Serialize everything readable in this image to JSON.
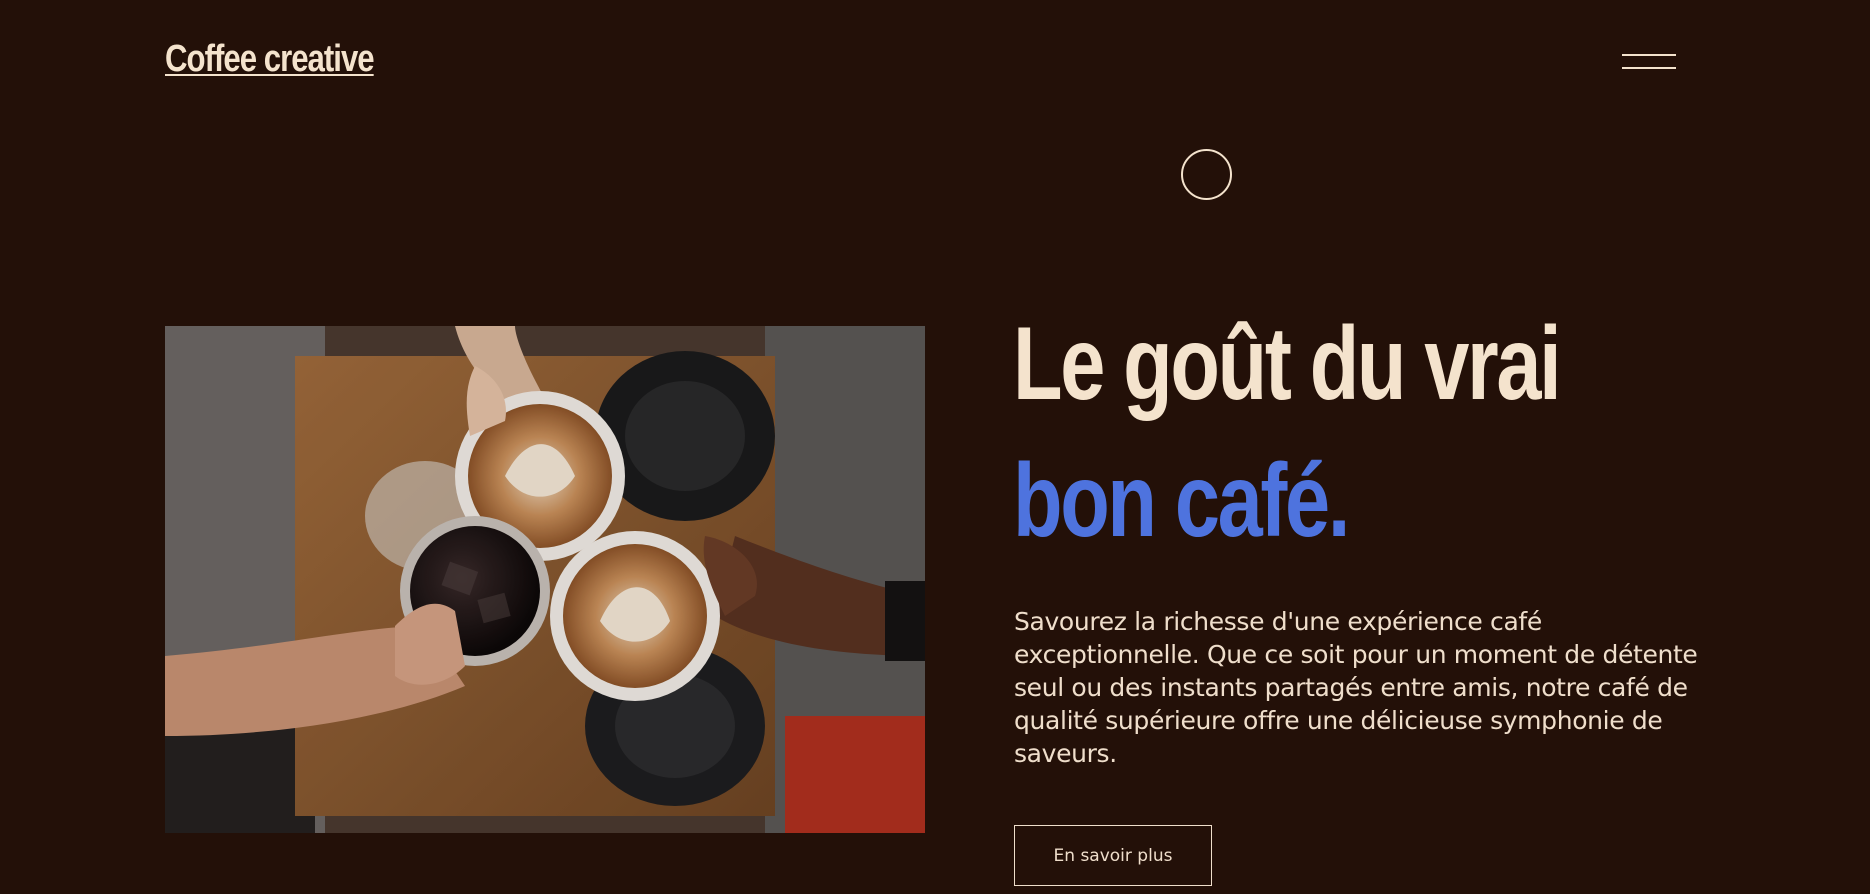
{
  "header": {
    "logo_text": "Coffee creative",
    "menu_icon": "hamburger-menu-icon"
  },
  "decor": {
    "circle_icon": "circle-outline-icon"
  },
  "hero": {
    "image_description": "coffee-cheers-photo",
    "headline_line1": "Le goût du vrai",
    "headline_line2": "bon café.",
    "description": "Savourez la richesse d'une expérience café exceptionnelle. Que ce soit pour un moment de détente seul ou des instants partagés entre amis, notre café de qualité supérieure offre une délicieuse symphonie de saveurs.",
    "cta_label": "En savoir plus"
  },
  "colors": {
    "background": "#231008",
    "cream": "#f4e3cd",
    "accent_blue": "#4e73de"
  }
}
